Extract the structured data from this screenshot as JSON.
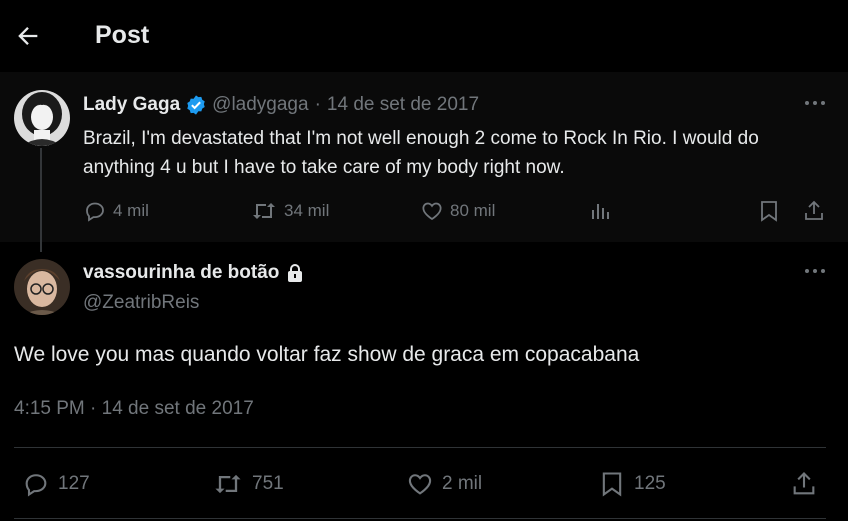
{
  "header": {
    "title": "Post",
    "back_icon": "arrow-left-icon"
  },
  "colors": {
    "background": "#000000",
    "text": "#e7e9ea",
    "muted": "#71767b",
    "verified": "#1d9bf0",
    "divider": "#2f3336"
  },
  "parent_tweet": {
    "display_name": "Lady Gaga",
    "verified": true,
    "handle": "@ladygaga",
    "separator": "·",
    "date": "14 de set de 2017",
    "text": "Brazil, I'm devastated that I'm not well enough 2 come to Rock In Rio. I would do anything 4 u but I have to take care of my body right now.",
    "actions": {
      "replies": "4 mil",
      "retweets": "34 mil",
      "likes": "80 mil"
    }
  },
  "reply_tweet": {
    "display_name": "vassourinha de botão",
    "locked": true,
    "handle": "@ZeatribReis",
    "text": "We love you mas quando voltar faz show de graca em copacabana",
    "timestamp": "4:15 PM · 14 de set de 2017",
    "actions": {
      "replies": "127",
      "retweets": "751",
      "likes": "2 mil",
      "bookmarks": "125"
    }
  }
}
